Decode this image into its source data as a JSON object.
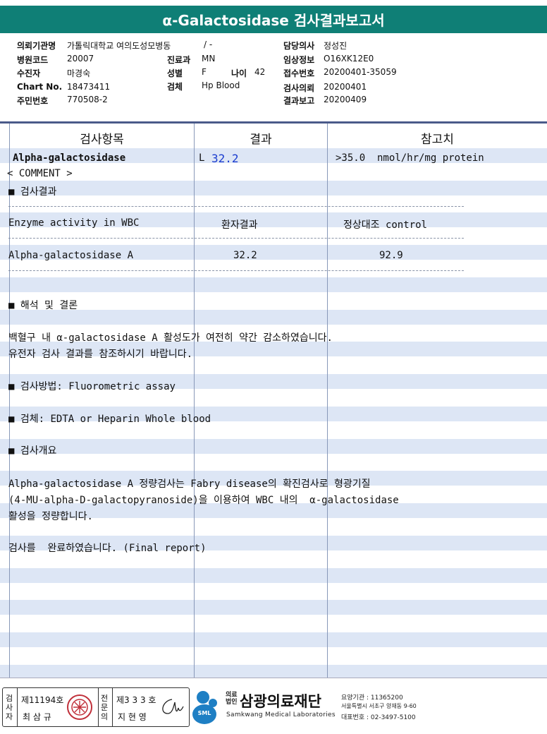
{
  "title": "α-Galactosidase 검사결과보고서",
  "info": {
    "institution_label": "의뢰기관명",
    "institution_value": "가톨릭대학교 여의도성모병동",
    "institution_extra": "/ -",
    "hospital_code_label": "병원코드",
    "hospital_code_value": "20007",
    "dept_label": "진료과",
    "dept_value": "MN",
    "patient_label": "수진자",
    "patient_value": "마경숙",
    "sex_label": "성별",
    "sex_value": "F",
    "age_label": "나이",
    "age_value": "42",
    "chart_label": "Chart No.",
    "chart_value": "18473411",
    "specimen_label": "검체",
    "specimen_value": "Hp Blood",
    "id_label": "주민번호",
    "id_value": "770508-2",
    "doctor_label": "담당의사",
    "doctor_value": "정성진",
    "clinical_label": "임상정보",
    "clinical_value": "O16XK12E0",
    "receipt_label": "접수번호",
    "receipt_value": "20200401-35059",
    "request_label": "검사의뢰",
    "request_value": "20200401",
    "result_date_label": "결과보고",
    "result_date_value": "20200409"
  },
  "table": {
    "col_item": "검사항목",
    "col_result": "결과",
    "col_reference": "참고치",
    "row_item": "Alpha-galactosidase",
    "row_flag": "L",
    "row_value": "32.2",
    "row_reference": ">35.0  nmol/hr/mg protein"
  },
  "comment": {
    "header": "< COMMENT >",
    "section_result": "■ 검사결과",
    "col_enzyme": "Enzyme activity in WBC",
    "col_patient": "환자결과",
    "col_control": "정상대조 control",
    "enzyme_name": "Alpha-galactosidase A",
    "patient_value": "32.2",
    "control_value": "92.9",
    "section_interpretation": "■ 해석 및 결론",
    "interp_line1": "백혈구 내 α-galactosidase A 활성도가 여전히 약간 감소하였습니다.",
    "interp_line2": "유전자 검사 결과를 참조하시기 바랍니다.",
    "method": "■ 검사방법: Fluorometric assay",
    "specimen": "■ 검체: EDTA or Heparin Whole blood",
    "section_overview": "■ 검사개요",
    "overview_line1": "Alpha-galactosidase A 정량검사는 Fabry disease의 확진검사로 형광기질",
    "overview_line2": "(4-MU-alpha-D-galactopyranoside)을 이용하여 WBC 내의  α-galactosidase",
    "overview_line3": "활성을 정량합니다.",
    "final": "검사를  완료하였습니다. (Final report)"
  },
  "footer": {
    "inspector_label": "검사자",
    "inspector_license": "제11194호",
    "inspector_name": "최 삼 규",
    "specialist_label": "전문의",
    "specialist_license": "제3 3 3 호",
    "specialist_name": "지 현 영",
    "sml_logo_text": "SML",
    "org_corp_label_1": "의료",
    "org_corp_label_2": "법인",
    "org_name": "삼광의료재단",
    "org_name_en": "Samkwang Medical Laboratories",
    "org_code": "요양기관 : 11365200",
    "org_address": "서울특별시 서초구 양재동 9-60",
    "org_phone": "대표번호 : 02-3497-5100"
  },
  "colors": {
    "title_bar": "#0f7f76",
    "stripe": "#dde6f5",
    "result_value": "#1a3ccf",
    "logo_blue": "#1e7fc4"
  }
}
